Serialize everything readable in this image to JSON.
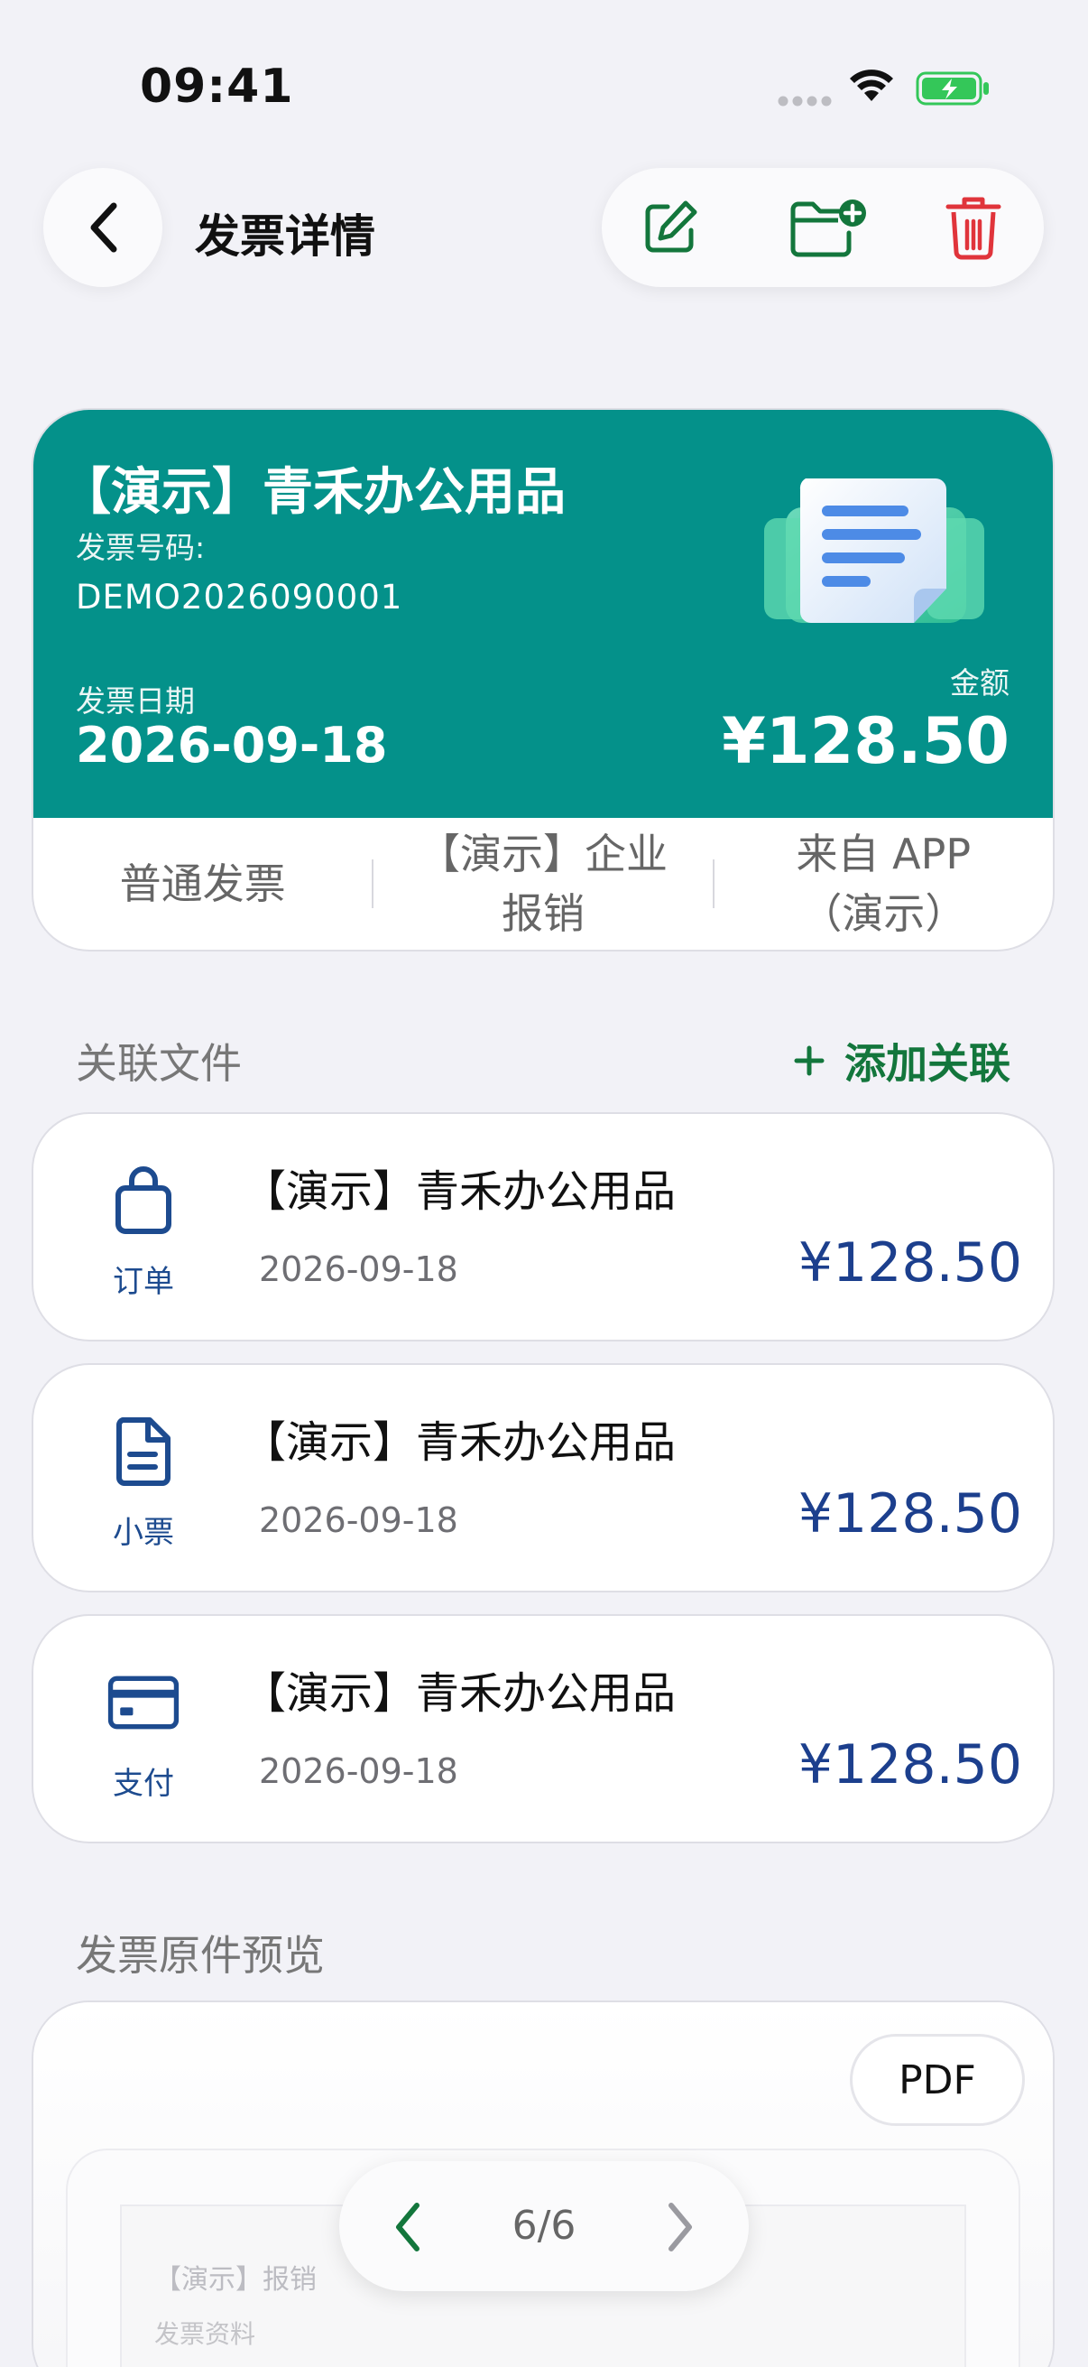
{
  "status_bar": {
    "time": "09:41"
  },
  "nav": {
    "title": "发票详情"
  },
  "invoice": {
    "vendor": "【演示】青禾办公用品",
    "number_label": "发票号码:",
    "number": "DEMO2026090001",
    "date_label": "发票日期",
    "date": "2026-09-18",
    "amount_label": "金额",
    "amount": "¥128.50",
    "tags": [
      {
        "line1": "普通发票",
        "line2": ""
      },
      {
        "line1": "【演示】企业",
        "line2": "报销"
      },
      {
        "line1": "来自 APP",
        "line2": "（演示）"
      }
    ],
    "accent_color": "#04918a"
  },
  "related": {
    "section_title": "关联文件",
    "add_label": "添加关联",
    "items": [
      {
        "kind": "订单",
        "icon": "bag-icon",
        "title": "【演示】青禾办公用品",
        "date": "2026-09-18",
        "amount": "¥128.50"
      },
      {
        "kind": "小票",
        "icon": "receipt-doc-icon",
        "title": "【演示】青禾办公用品",
        "date": "2026-09-18",
        "amount": "¥128.50"
      },
      {
        "kind": "支付",
        "icon": "credit-card-icon",
        "title": "【演示】青禾办公用品",
        "date": "2026-09-18",
        "amount": "¥128.50"
      }
    ]
  },
  "preview": {
    "section_title": "发票原件预览",
    "format_badge": "PDF",
    "doc_heading": "【演示】报销",
    "doc_subheading": "发票资料",
    "pager": "6/6"
  },
  "colors": {
    "edit": "#13763c",
    "delete": "#e0343b",
    "amount_blue": "#1c3f8d",
    "link_green": "#13763c"
  }
}
